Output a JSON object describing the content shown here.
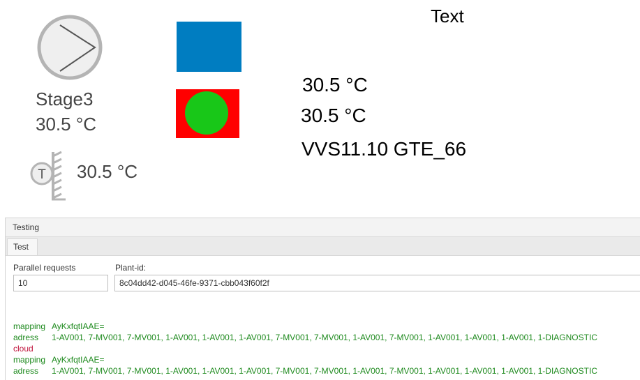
{
  "canvas": {
    "stage": {
      "label": "Stage3",
      "temperature": "30.5 °C"
    },
    "sensor": {
      "letter": "T",
      "temperature": "30.5 °C"
    },
    "text_label": "Text",
    "readings": [
      "30.5 °C",
      "30.5 °C"
    ],
    "equipment_label": "VVS11.10 GTE_66",
    "colors": {
      "blue_block": "#007dc1",
      "status_background": "#ff0000",
      "status_indicator": "#18c718",
      "symbol_gray": "#b4b4b4"
    },
    "icons": [
      "pump-icon",
      "temperature-sensor-icon"
    ]
  },
  "panel": {
    "title": "Testing",
    "tab": "Test",
    "parallel_requests": {
      "label": "Parallel requests",
      "value": "10"
    },
    "plant_id": {
      "label": "Plant-id:",
      "value": "8c04dd42-d045-46fe-9371-cbb043f60f2f"
    },
    "log": [
      {
        "key": "mapping",
        "value": "AyKxfqtIAAE=",
        "kind": "ok"
      },
      {
        "key": "adress",
        "value": "1-AV001, 7-MV001, 7-MV001, 1-AV001, 1-AV001, 1-AV001, 7-MV001, 7-MV001, 1-AV001, 7-MV001, 1-AV001, 1-AV001, 1-AV001, 1-DIAGNOSTIC",
        "kind": "ok"
      },
      {
        "key": "cloud",
        "value": "",
        "kind": "cloud"
      },
      {
        "key": "mapping",
        "value": "AyKxfqtIAAE=",
        "kind": "ok"
      },
      {
        "key": "adress",
        "value": "1-AV001, 7-MV001, 7-MV001, 1-AV001, 1-AV001, 1-AV001, 7-MV001, 7-MV001, 1-AV001, 7-MV001, 1-AV001, 1-AV001, 1-AV001, 1-DIAGNOSTIC",
        "kind": "ok"
      }
    ]
  }
}
